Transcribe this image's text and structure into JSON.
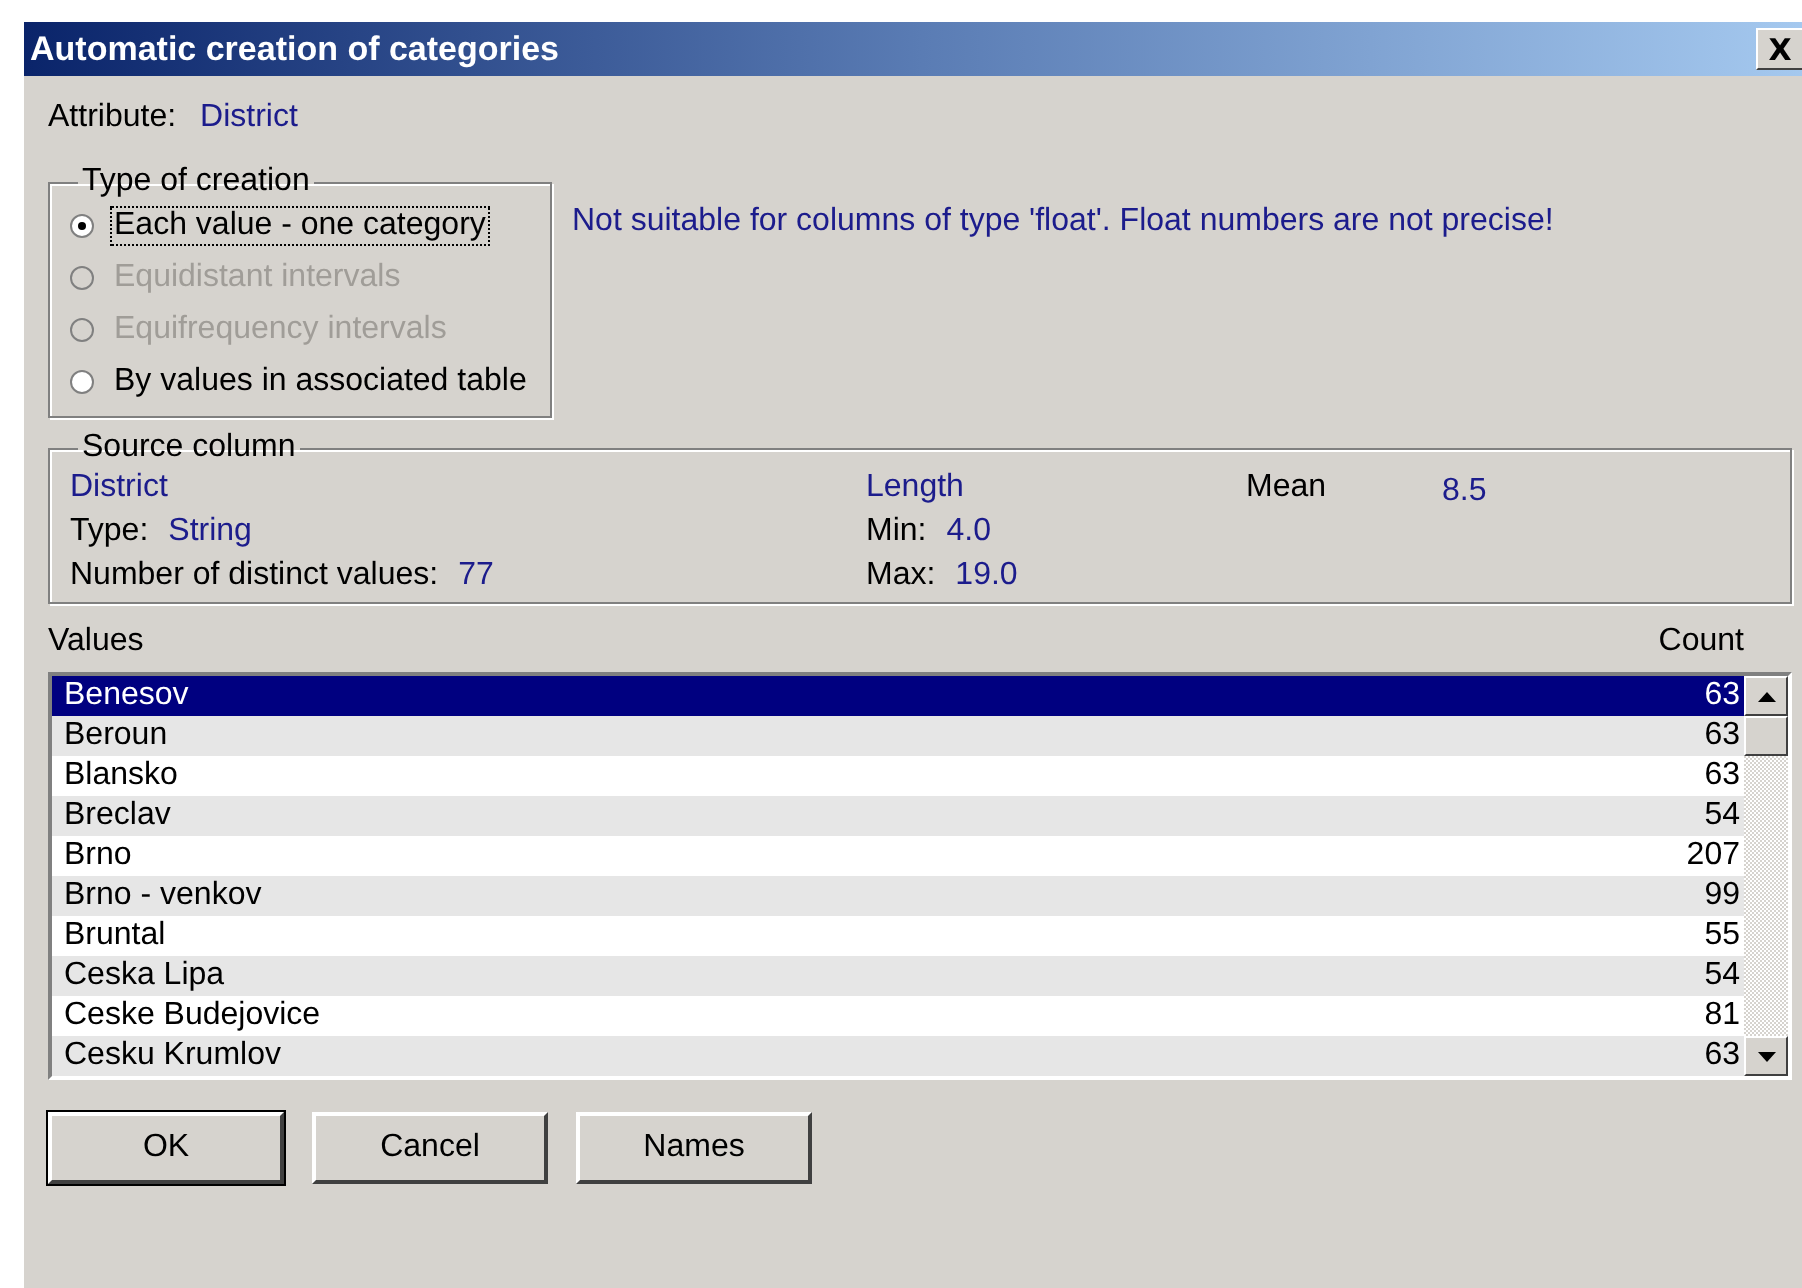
{
  "window": {
    "title": "Automatic creation of categories",
    "close": "X"
  },
  "attribute": {
    "label": "Attribute:",
    "value": "District"
  },
  "type_of_creation": {
    "title": "Type of creation",
    "options": [
      {
        "label": "Each value - one category",
        "selected": true,
        "disabled": false,
        "focused": true
      },
      {
        "label": "Equidistant intervals",
        "selected": false,
        "disabled": true,
        "focused": false
      },
      {
        "label": "Equifrequency intervals",
        "selected": false,
        "disabled": true,
        "focused": false
      },
      {
        "label": "By values in associated table",
        "selected": false,
        "disabled": false,
        "focused": false
      }
    ]
  },
  "message": "Not suitable for columns of type 'float'. Float numbers are not precise!",
  "source_column": {
    "title": "Source column",
    "name": "District",
    "type_label": "Type:",
    "type_value": "String",
    "distinct_label": "Number of distinct values:",
    "distinct_value": "77",
    "length_label": "Length",
    "min_label": "Min:",
    "min_value": "4.0",
    "max_label": "Max:",
    "max_value": "19.0",
    "mean_label": "Mean",
    "mean_value": "8.5"
  },
  "values": {
    "columns": [
      "Values",
      "Count"
    ],
    "rows": [
      {
        "name": "Benesov",
        "count": "63",
        "selected": true
      },
      {
        "name": "Beroun",
        "count": "63",
        "selected": false
      },
      {
        "name": "Blansko",
        "count": "63",
        "selected": false
      },
      {
        "name": "Breclav",
        "count": "54",
        "selected": false
      },
      {
        "name": "Brno",
        "count": "207",
        "selected": false
      },
      {
        "name": "Brno - venkov",
        "count": "99",
        "selected": false
      },
      {
        "name": "Bruntal",
        "count": "55",
        "selected": false
      },
      {
        "name": "Ceska Lipa",
        "count": "54",
        "selected": false
      },
      {
        "name": "Ceske Budejovice",
        "count": "81",
        "selected": false
      },
      {
        "name": "Cesku Krumlov",
        "count": "63",
        "selected": false
      }
    ]
  },
  "buttons": [
    {
      "label": "OK",
      "default": true
    },
    {
      "label": "Cancel",
      "default": false
    },
    {
      "label": "Names",
      "default": false
    }
  ]
}
